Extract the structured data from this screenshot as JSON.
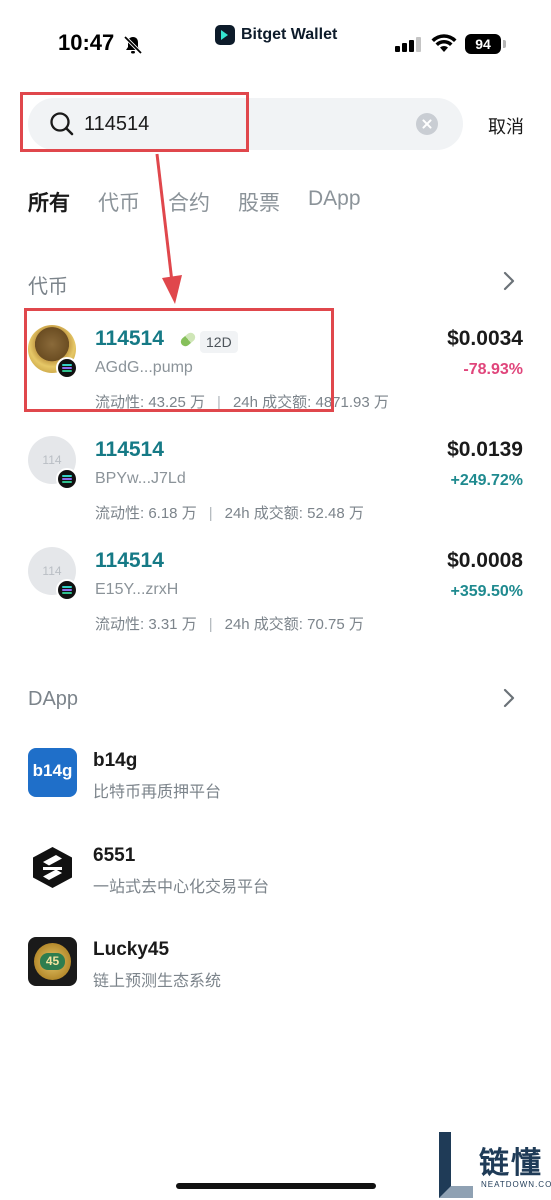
{
  "status_bar": {
    "time": "10:47",
    "brand": "Bitget Wallet",
    "battery": "94"
  },
  "search": {
    "value": "114514",
    "placeholder": "",
    "cancel_label": "取消"
  },
  "tabs": [
    {
      "label": "所有",
      "active": true
    },
    {
      "label": "代币",
      "active": false
    },
    {
      "label": "合约",
      "active": false
    },
    {
      "label": "股票",
      "active": false
    },
    {
      "label": "DApp",
      "active": false
    }
  ],
  "tokens_section": {
    "title": "代币",
    "items": [
      {
        "name": "114514",
        "badge": "12D",
        "address": "AGdG...pump",
        "liquidity": "流动性: 43.25 万",
        "volume": "24h 成交额: 4871.93 万",
        "price": "$0.0034",
        "change": "-78.93%",
        "avatar_text": ""
      },
      {
        "name": "114514",
        "badge": "",
        "address": "BPYw...J7Ld",
        "liquidity": "流动性: 6.18 万",
        "volume": "24h 成交额: 52.48 万",
        "price": "$0.0139",
        "change": "+249.72%",
        "avatar_text": "114"
      },
      {
        "name": "114514",
        "badge": "",
        "address": "E15Y...zrxH",
        "liquidity": "流动性: 3.31 万",
        "volume": "24h 成交额: 70.75 万",
        "price": "$0.0008",
        "change": "+359.50%",
        "avatar_text": "114"
      }
    ]
  },
  "dapp_section": {
    "title": "DApp",
    "items": [
      {
        "name": "b14g",
        "desc": "比特币再质押平台",
        "icon_text": "b14g"
      },
      {
        "name": "6551",
        "desc": "一站式去中心化交易平台",
        "icon_text": ""
      },
      {
        "name": "Lucky45",
        "desc": "链上预测生态系统",
        "icon_text": "45"
      }
    ]
  },
  "watermark": {
    "text": "链懂",
    "sub": "NEATDOWN.COM"
  },
  "colors": {
    "accent_teal": "#167a86",
    "negative": "#e0457b",
    "positive": "#1f8a8f",
    "annotation_red": "#e0474c"
  }
}
